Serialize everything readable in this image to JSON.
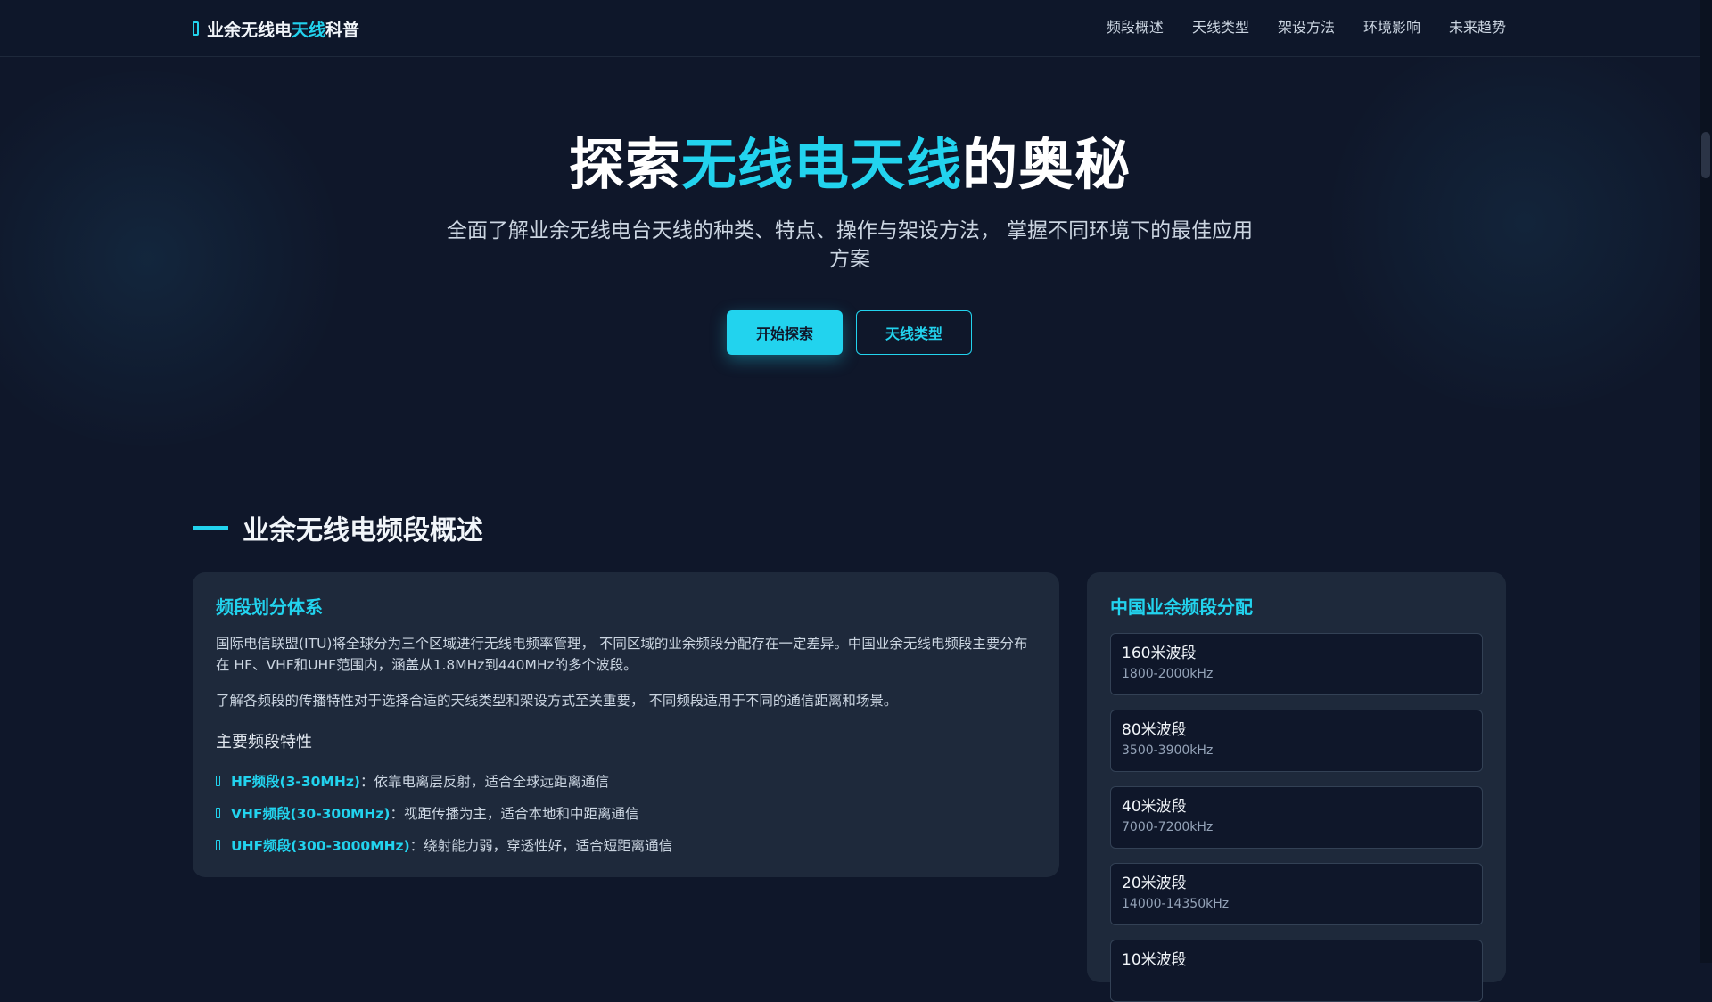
{
  "nav": {
    "logo_prefix": "业余无线电",
    "logo_accent": "天线",
    "logo_suffix": "科普",
    "links": [
      "频段概述",
      "天线类型",
      "架设方法",
      "环境影响",
      "未来趋势"
    ]
  },
  "hero": {
    "title_prefix": "探索",
    "title_accent": "无线电天线",
    "title_suffix": "的奥秘",
    "subtitle": "全面了解业余无线电台天线的种类、特点、操作与架设方法， 掌握不同环境下的最佳应用方案",
    "primary_button": "开始探索",
    "secondary_button": "天线类型"
  },
  "section": {
    "title": "业余无线电频段概述"
  },
  "main_card": {
    "heading": "频段划分体系",
    "para1": "国际电信联盟(ITU)将全球分为三个区域进行无线电频率管理， 不同区域的业余频段分配存在一定差异。中国业余无线电频段主要分布在 HF、VHF和UHF范围内，涵盖从1.8MHz到440MHz的多个波段。",
    "para2": "了解各频段的传播特性对于选择合适的天线类型和架设方式至关重要， 不同频段适用于不同的通信距离和场景。",
    "features_heading": "主要频段特性",
    "features": [
      {
        "key": "HF频段(3-30MHz)",
        "desc": "：依靠电离层反射，适合全球远距离通信"
      },
      {
        "key": "VHF频段(30-300MHz)",
        "desc": "：视距传播为主，适合本地和中距离通信"
      },
      {
        "key": "UHF频段(300-3000MHz)",
        "desc": "：绕射能力弱，穿透性好，适合短距离通信"
      }
    ]
  },
  "side_card": {
    "heading": "中国业余频段分配",
    "bands": [
      {
        "name": "160米波段",
        "range": "1800-2000kHz"
      },
      {
        "name": "80米波段",
        "range": "3500-3900kHz"
      },
      {
        "name": "40米波段",
        "range": "7000-7200kHz"
      },
      {
        "name": "20米波段",
        "range": "14000-14350kHz"
      },
      {
        "name": "10米波段",
        "range": ""
      }
    ]
  },
  "colors": {
    "background": "#0f172a",
    "card": "#1e293b",
    "accent": "#22d3ee"
  }
}
